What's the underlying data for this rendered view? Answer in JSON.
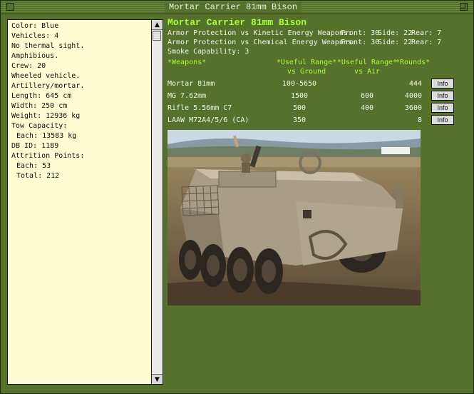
{
  "window": {
    "title": "Mortar Carrier 81mm Bison"
  },
  "sidebar": {
    "lines": [
      {
        "text": "Color: Blue"
      },
      {
        "text": "Vehicles: 4"
      },
      {
        "text": "No thermal sight."
      },
      {
        "text": "Amphibious."
      },
      {
        "text": "Crew: 20"
      },
      {
        "text": "Wheeled vehicle."
      },
      {
        "text": "Artillery/mortar."
      },
      {
        "text": "Length: 645 cm"
      },
      {
        "text": "Width: 250 cm"
      },
      {
        "text": "Weight: 12936 kg"
      },
      {
        "text": "Tow Capacity:"
      },
      {
        "text": "Each: 13583 kg",
        "indent": true
      },
      {
        "text": "DB ID: 1189"
      },
      {
        "text": "Attrition Points:"
      },
      {
        "text": "Each: 53",
        "indent": true
      },
      {
        "text": "Total: 212",
        "indent": true
      }
    ]
  },
  "unit": {
    "name": "Mortar Carrier 81mm Bison",
    "armor": [
      {
        "label": "Armor Protection vs Kinetic Energy Weapons:",
        "front": "Front: 30",
        "side": "Side: 22",
        "rear": "Rear: 7"
      },
      {
        "label": "Armor Protection vs Chemical Energy Weapons:",
        "front": "Front: 30",
        "side": "Side: 22",
        "rear": "Rear: 7"
      }
    ],
    "smoke": "Smoke Capability: 3"
  },
  "weapons_table": {
    "headers": {
      "weapons": "*Weapons*",
      "ground_1": "*Useful Range*",
      "ground_2": "vs Ground",
      "air_1": "*Useful Range*",
      "air_2": "vs Air",
      "rounds": "*Rounds*"
    },
    "rows": [
      {
        "name": "Mortar 81mm",
        "ground": "100-5650",
        "air": "",
        "rounds": "444",
        "info": "Info"
      },
      {
        "name": "MG 7.62mm",
        "ground": "1500",
        "air": "600",
        "rounds": "4000",
        "info": "Info"
      },
      {
        "name": "Rifle 5.56mm C7",
        "ground": "500",
        "air": "400",
        "rounds": "3600",
        "info": "Info"
      },
      {
        "name": "LAAW M72A4/5/6 (CA)",
        "ground": "350",
        "air": "",
        "rounds": "8",
        "info": "Info"
      }
    ]
  },
  "colors": {
    "background": "#55712c",
    "heading_green": "#a6ff3a",
    "sidebar_bg": "#fffcd4"
  }
}
